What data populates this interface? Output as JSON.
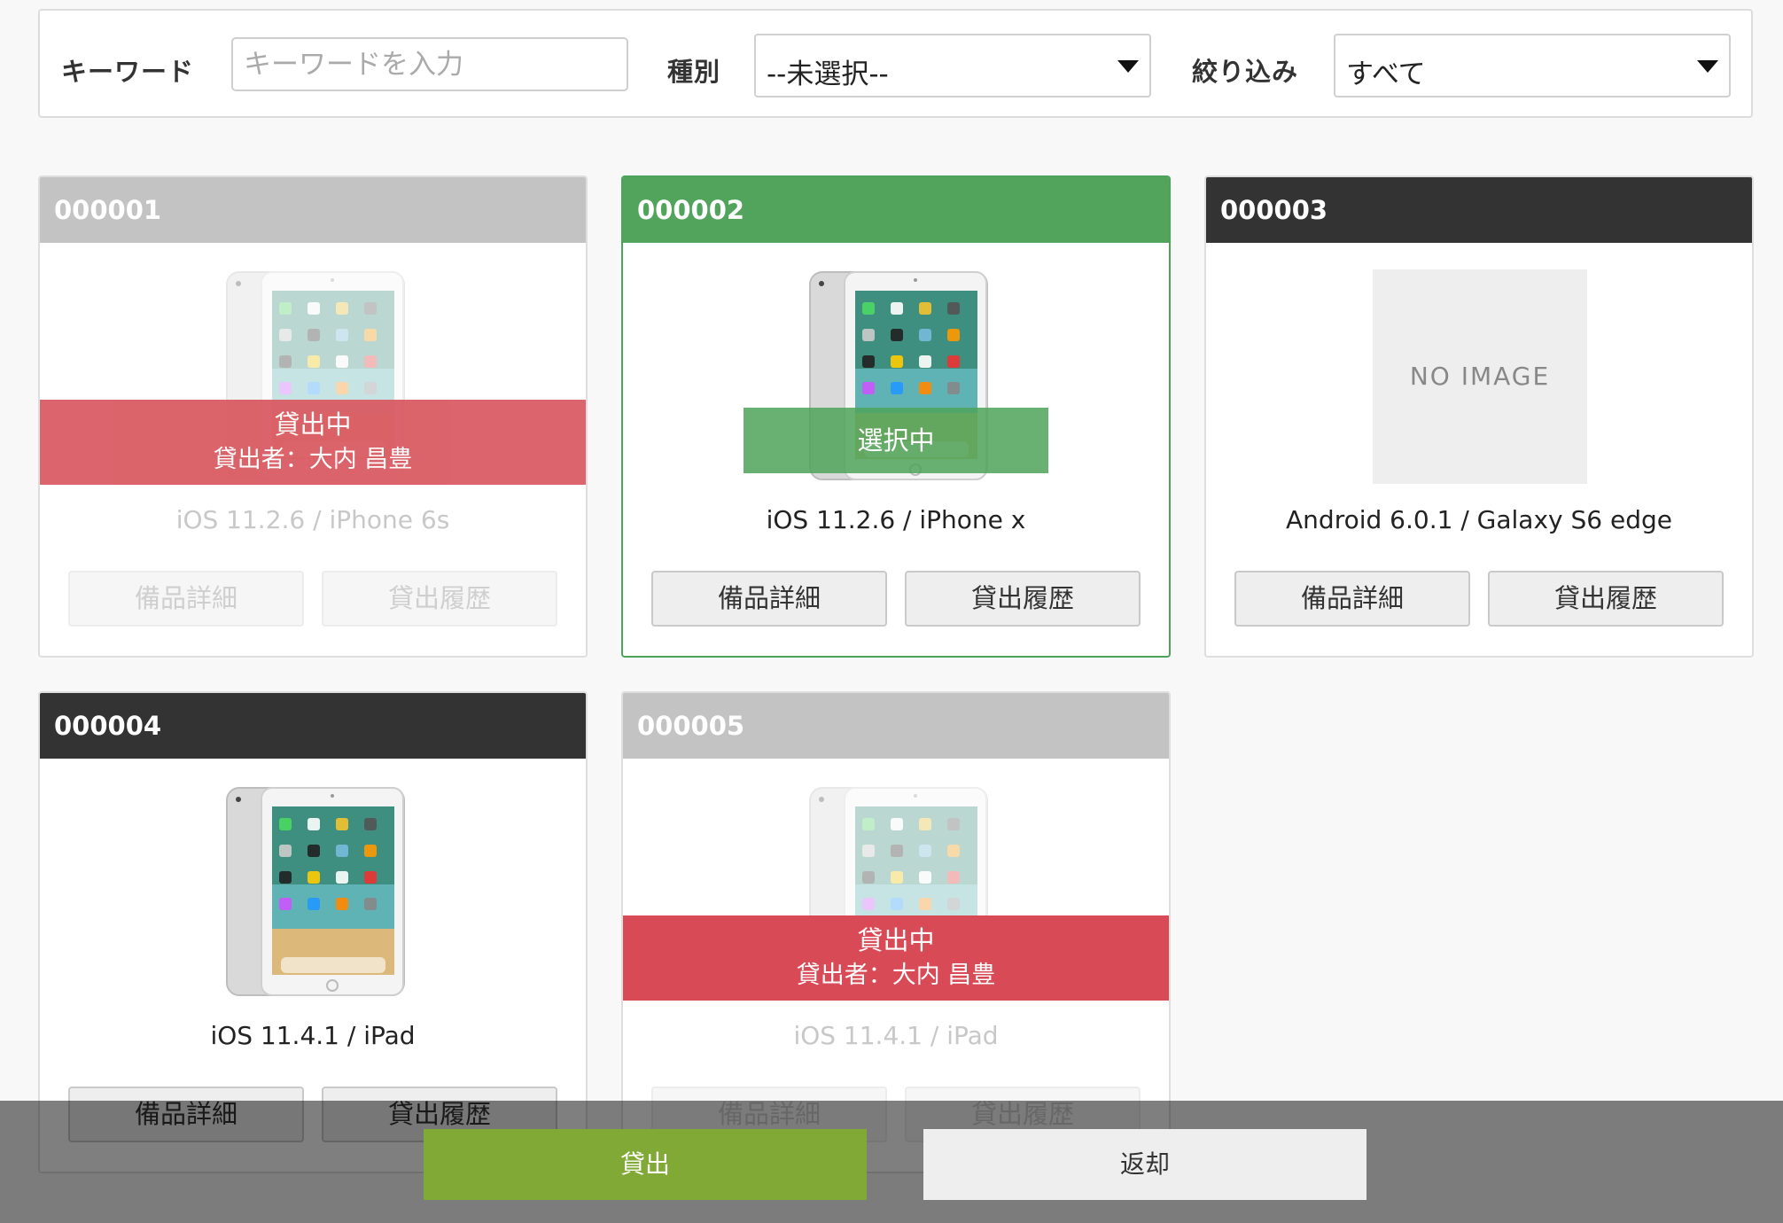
{
  "filters": {
    "keyword_label": "キーワード",
    "keyword_placeholder": "キーワードを入力",
    "type_label": "種別",
    "type_value": "--未選択--",
    "filter_label": "絞り込み",
    "filter_value": "すべて"
  },
  "colors": {
    "header_gray": "#c3c3c3",
    "header_green": "#52a45c",
    "header_dark": "#333333",
    "lent_red": "#d9575f",
    "lend_button": "#80a935",
    "return_button": "#eeeeee"
  },
  "items": [
    {
      "id": "000001",
      "name": "iOS 11.2.6 / iPhone 6s",
      "status": "貸出中",
      "borrower": "貸出者：大内 昌豊",
      "detail_label": "備品詳細",
      "history_label": "貸出履歴"
    },
    {
      "id": "000002",
      "name": "iOS 11.2.6 / iPhone x",
      "selected_label": "選択中",
      "detail_label": "備品詳細",
      "history_label": "貸出履歴"
    },
    {
      "id": "000003",
      "name": "Android 6.0.1 / Galaxy S6 edge",
      "no_image": "NO IMAGE",
      "detail_label": "備品詳細",
      "history_label": "貸出履歴"
    },
    {
      "id": "000004",
      "name": "iOS 11.4.1 / iPad",
      "detail_label": "備品詳細",
      "history_label": "貸出履歴"
    },
    {
      "id": "000005",
      "name": "iOS 11.4.1 / iPad",
      "status": "貸出中",
      "borrower": "貸出者：大内 昌豊",
      "detail_label": "備品詳細",
      "history_label": "貸出履歴"
    }
  ],
  "actions": {
    "lend_label": "貸出",
    "return_label": "返却"
  }
}
